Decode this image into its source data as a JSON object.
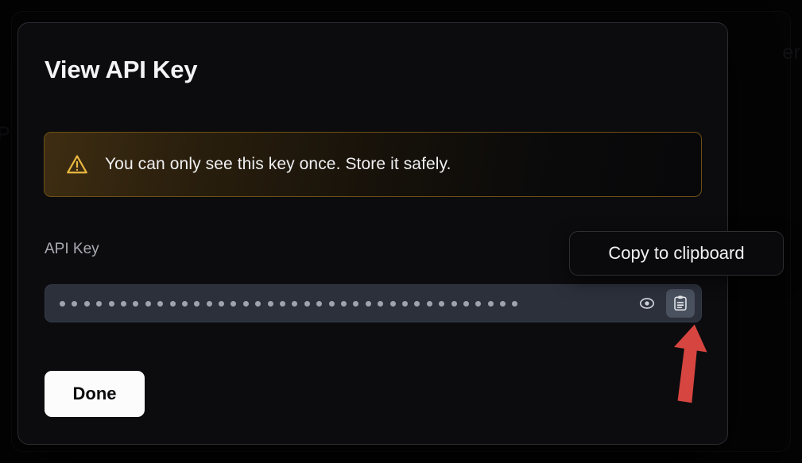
{
  "background": {
    "partial_text_right": "er",
    "partial_text_left": "P",
    "partial_text_topbar": "   "
  },
  "modal": {
    "title": "View API Key",
    "warning": {
      "icon": "warning-triangle-icon",
      "message": "You can only see this key once. Store it safely."
    },
    "api_key_field": {
      "label": "API Key",
      "masked_value": "••••••••••••••••••••••••••••••••••••••",
      "masked_dot_count": 38,
      "actions": [
        {
          "name": "reveal-key-button",
          "icon": "eye-icon",
          "hovered": false
        },
        {
          "name": "copy-key-button",
          "icon": "clipboard-icon",
          "hovered": true
        }
      ]
    },
    "tooltip": {
      "text": "Copy to clipboard",
      "target": "copy-key-button"
    },
    "done_button": {
      "label": "Done"
    }
  },
  "annotation": {
    "arrow": {
      "color": "#d6453f",
      "points_to": "copy-key-button",
      "direction": "up"
    }
  },
  "colors": {
    "modal_bg": "#0c0c0f",
    "modal_border": "#2c2c31",
    "warning_border": "#6d5014",
    "warning_icon": "#e8b740",
    "input_bg": "#2b303b",
    "icon_hover_bg": "#4a515f",
    "done_bg": "#fcfcfc",
    "done_text": "#09090b",
    "arrow_red": "#d6453f"
  }
}
